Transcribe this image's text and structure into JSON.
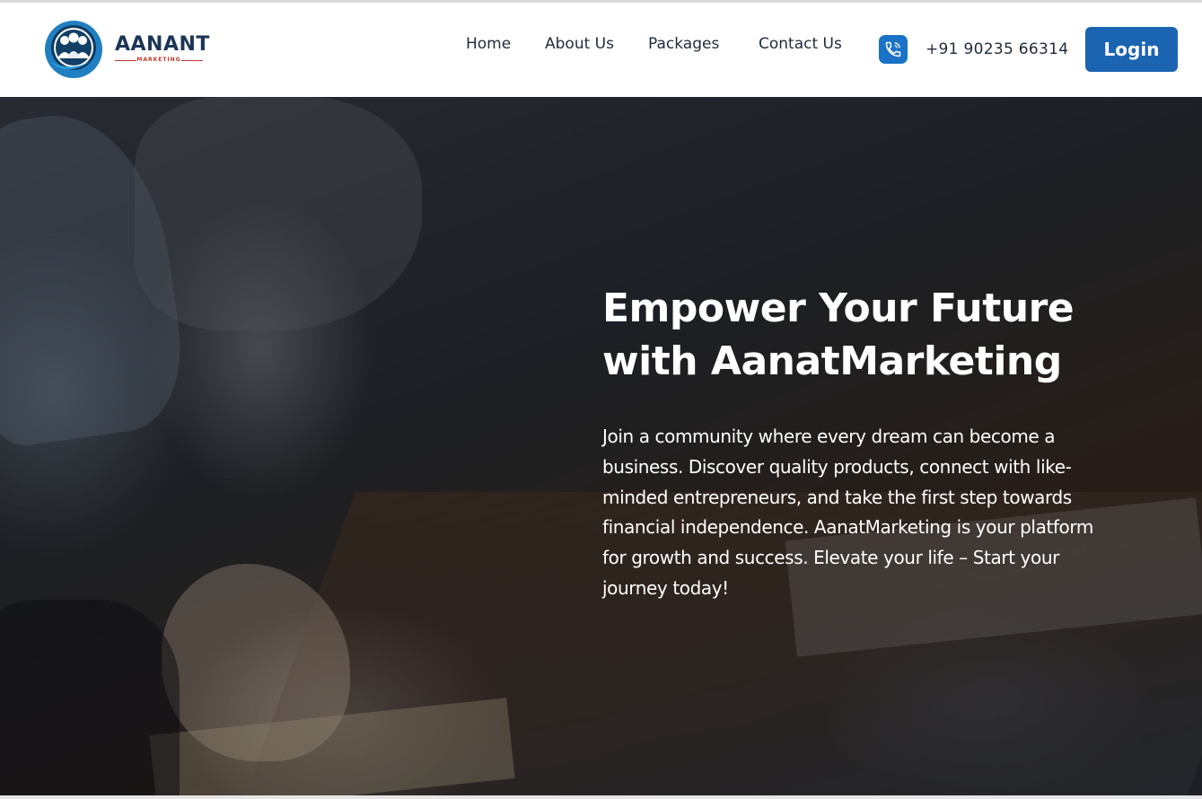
{
  "brand": {
    "name": "AANANT",
    "subtitle": "MARKETING",
    "logo_icon": "people-circle-logo-icon"
  },
  "nav": {
    "items": [
      {
        "label": "Home"
      },
      {
        "label": "About Us"
      },
      {
        "label": "Packages"
      },
      {
        "label": "Contact Us"
      }
    ],
    "phone_icon": "phone-icon",
    "phone": "+91 90235 66314",
    "login_label": "Login"
  },
  "hero": {
    "title_line1": "Empower Your Future",
    "title_line2": "with AanatMarketing",
    "description": "Join a community where every dream can become a business. Discover quality products, connect with like-minded entrepreneurs, and take the first step towards financial independence. AanatMarketing is your platform for growth and success. Elevate your life – Start your journey today!"
  },
  "colors": {
    "brand_blue": "#1b64b2",
    "phone_icon_bg": "#1a73c7",
    "brand_navy": "#1c3557",
    "brand_red": "#c0392b",
    "nav_text": "#1f2a3a"
  }
}
